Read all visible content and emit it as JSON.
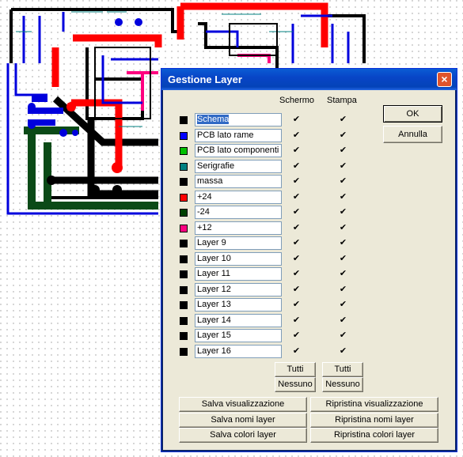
{
  "dialog": {
    "title": "Gestione Layer",
    "close_icon": "×",
    "col_screen": "Schermo",
    "col_print": "Stampa",
    "ok_label": "OK",
    "cancel_label": "Annulla",
    "tutti1": "Tutti",
    "nessuno1": "Nessuno",
    "tutti2": "Tutti",
    "nessuno2": "Nessuno",
    "save_view": "Salva visualizzazione",
    "restore_view": "Ripristina visualizzazione",
    "save_names": "Salva nomi layer",
    "restore_names": "Ripristina nomi layer",
    "save_colors": "Salva colori layer",
    "restore_colors": "Ripristina colori layer",
    "check_glyph": "✔"
  },
  "layers": [
    {
      "name": "Schema",
      "color": "#000000"
    },
    {
      "name": "PCB lato rame",
      "color": "#0000ff"
    },
    {
      "name": "PCB lato componenti",
      "color": "#00c000"
    },
    {
      "name": "Serigrafie",
      "color": "#008080"
    },
    {
      "name": "massa",
      "color": "#000000"
    },
    {
      "name": "+24",
      "color": "#ff0000"
    },
    {
      "name": "-24",
      "color": "#004000"
    },
    {
      "name": "+12",
      "color": "#ff0080"
    },
    {
      "name": "Layer 9",
      "color": "#000000"
    },
    {
      "name": "Layer 10",
      "color": "#000000"
    },
    {
      "name": "Layer 11",
      "color": "#000000"
    },
    {
      "name": "Layer 12",
      "color": "#000000"
    },
    {
      "name": "Layer 13",
      "color": "#000000"
    },
    {
      "name": "Layer 14",
      "color": "#000000"
    },
    {
      "name": "Layer 15",
      "color": "#000000"
    },
    {
      "name": "Layer 16",
      "color": "#000000"
    }
  ],
  "colors": {
    "titlebar": "#0845c7",
    "dialog_bg": "#ece9d8",
    "selection": "#316ac5"
  }
}
